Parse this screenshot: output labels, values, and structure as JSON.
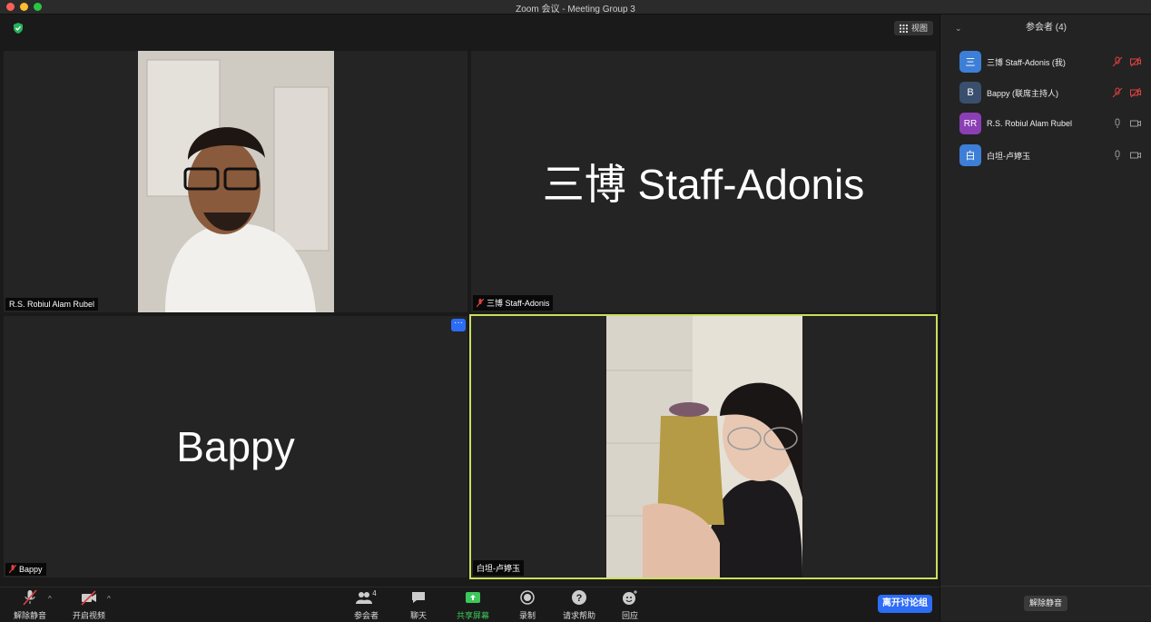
{
  "window": {
    "title": "Zoom 会议 - Meeting Group 3"
  },
  "header": {
    "view_label": "视图"
  },
  "tiles": [
    {
      "name": "R.S. Robiul Alam Rubel",
      "muted": false
    },
    {
      "name": "三博 Staff-Adonis",
      "big_name": "三博 Staff-Adonis",
      "muted": true
    },
    {
      "name": "Bappy",
      "big_name": "Bappy",
      "muted": true
    },
    {
      "name": "白坦-卢婷玉",
      "muted": false,
      "active_speaker": true
    }
  ],
  "tile_more_label": "···",
  "toolbar": {
    "unmute": "解除静音",
    "start_video": "开启视频",
    "participants": "参会者",
    "participants_count": "4",
    "chat": "聊天",
    "share_screen": "共享屏幕",
    "record": "录制",
    "ask_help": "请求帮助",
    "reactions": "回应",
    "leave_breakout": "离开讨论组"
  },
  "participants_panel": {
    "title": "参会者 (4)",
    "items": [
      {
        "avatar": "三",
        "name": "三博 Staff-Adonis (我)",
        "avatar_color": "#3d7fd6",
        "mic": "muted",
        "video": "off"
      },
      {
        "avatar": "B",
        "name": "Bappy (联席主持人)",
        "avatar_color": "#3a4f6e",
        "mic": "muted",
        "video": "off"
      },
      {
        "avatar": "RR",
        "name": "R.S. Robiul Alam Rubel",
        "avatar_color": "#8b3fb5",
        "mic": "on",
        "video": "on"
      },
      {
        "avatar": "白",
        "name": "白坦-卢婷玉",
        "avatar_color": "#3d7fd6",
        "mic": "on",
        "video": "on"
      }
    ],
    "unmute_all": "解除静音"
  },
  "colors": {
    "accent": "#2d6cf5",
    "speaker_border": "#c9df5b",
    "muted_red": "#e04040",
    "share_green": "#3cc85a"
  }
}
